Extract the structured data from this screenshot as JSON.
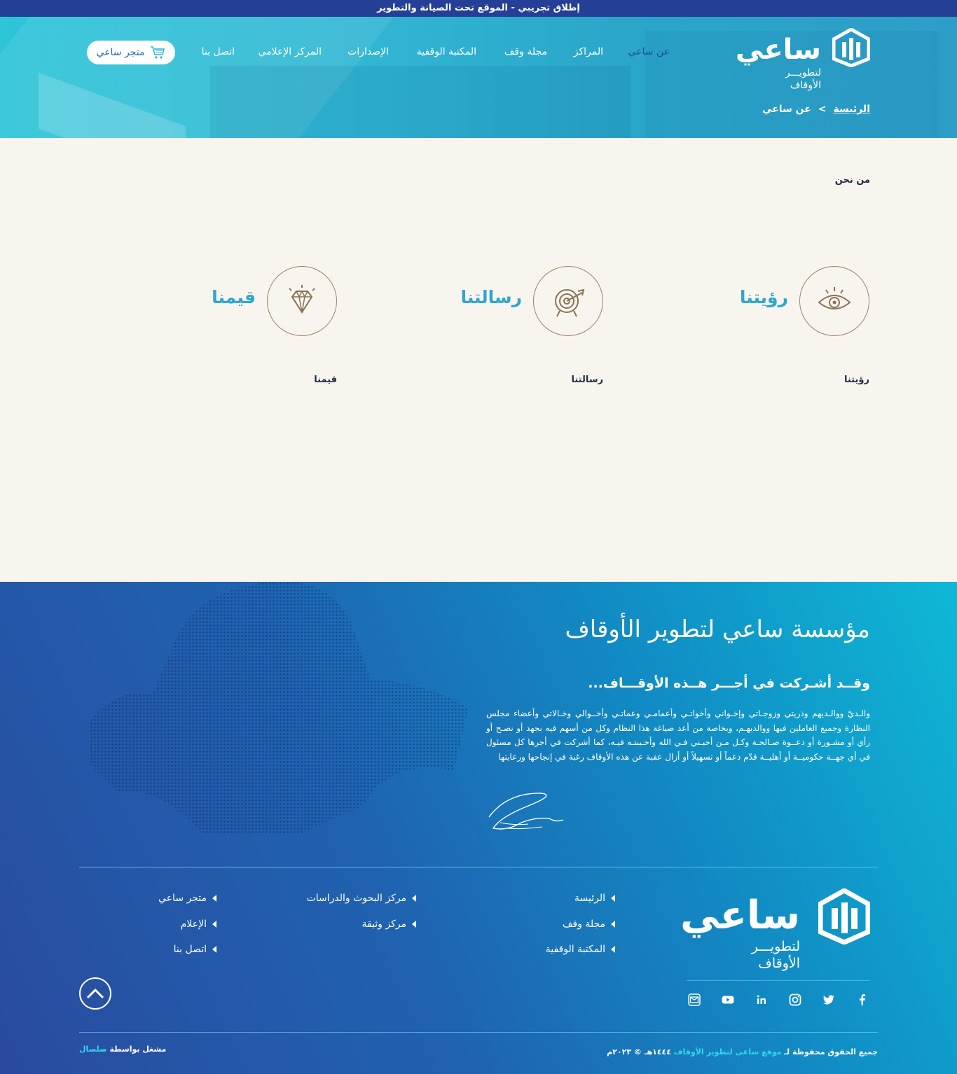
{
  "announcement": "إطلاق تجريبي - الموقع تحت الصيانة والتطوير",
  "logo": {
    "brand": "ساعي",
    "tagline_1": "لتطويـــر",
    "tagline_2": "الأوقاف"
  },
  "nav": {
    "items": [
      {
        "label": "عن ساعي",
        "active": true
      },
      {
        "label": "المراكز"
      },
      {
        "label": "مجلة وقف"
      },
      {
        "label": "المكتبة الوقفية"
      },
      {
        "label": "الإصدارات"
      },
      {
        "label": "المركز الإعلامي"
      },
      {
        "label": "اتصل بنا"
      }
    ],
    "store_button": "متجر ساعي"
  },
  "breadcrumb": {
    "home": "الرئيسة",
    "separator": ">",
    "current": "عن ساعي"
  },
  "main": {
    "section_title": "من نحن",
    "features": [
      {
        "title": "رؤيتنا",
        "caption": "رؤيتنا",
        "icon": "eye-icon"
      },
      {
        "title": "رسالتنا",
        "caption": "رسالتنا",
        "icon": "target-icon"
      },
      {
        "title": "قيمنا",
        "caption": "قيمنا",
        "icon": "diamond-icon"
      }
    ]
  },
  "footer": {
    "calligraphy": "مؤسسة ساعي لتطوير الأوقاف",
    "share_title": "وقــد أشـركت في أجـــر هــذه الأوقـــاف...",
    "paragraph": "والـديّ ووالـديهم وذريتي وزوجـاتي وإخـواني وأخواتـي وأعمامـي وعماتـي وأخــوالي وخـالاتي وأعضاء مجلس النظارة وجميع العاملين فيها ووالديهـم، وبخاصة من أعد صياغة هذا النظام وكل من أسهم فيه بجهد أو نصـح أو رأي أو مشـورة أو دعــوة صـالحـة وكـل مـن أحبـني فـي الله وأحـببتـه فيـه، كما أشركت في أجرها كل مسئول في أي جهــة حكوميــة أو أهليــة قدّم دعماً أو تسهيلاً أو أزال عقبة عن هذه الأوقاف رغبة في إنجاحها ورعايتها",
    "logo": {
      "brand": "ساعي",
      "tagline_1": "لتطويـــر",
      "tagline_2": "الأوقاف"
    },
    "links_col1": [
      "الرئيسة",
      "مجلة وقف",
      "المكتبة الوقفية"
    ],
    "links_col2": [
      "مركز البحوث والدراسات",
      "مركز وثيقة"
    ],
    "links_col3": [
      "متجر ساعي",
      "الإعلام",
      "اتصل بنا"
    ],
    "socials": [
      "facebook-icon",
      "twitter-icon",
      "instagram-icon",
      "linkedin-icon",
      "youtube-icon",
      "mail-icon"
    ],
    "copyright_prefix": "جميع الحقوق محفوظة لـ",
    "copyright_site": "موقع ساعي لتطوير الأوقاف",
    "copyright_suffix": "١٤٤٤هـ © ٢٠٢٣م",
    "powered_prefix": "مشغل بواسطة",
    "powered_name": "صلصال"
  },
  "colors": {
    "accent": "#2fa6cf",
    "announce_bg": "#243f95",
    "circle_border": "#9a8564",
    "page_bg": "#f8f5ef"
  }
}
